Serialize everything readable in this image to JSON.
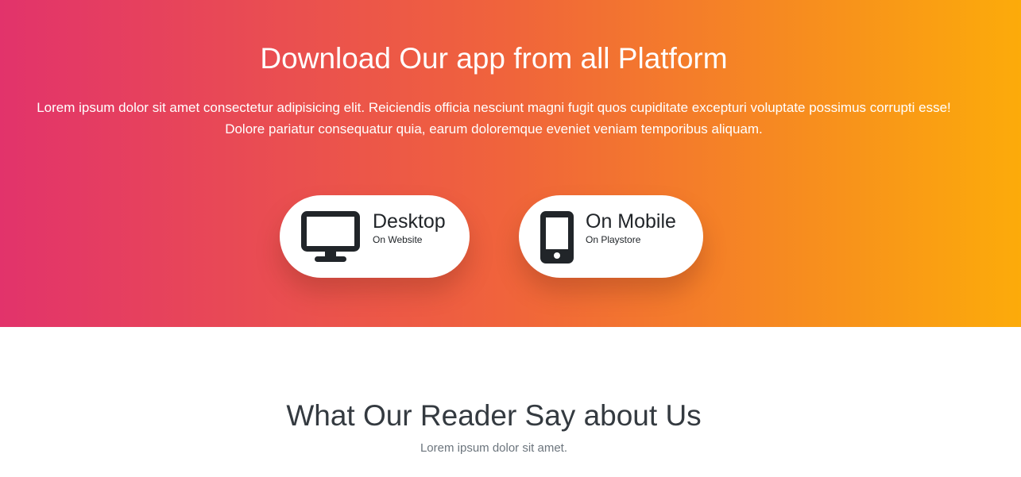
{
  "download": {
    "title": "Download Our app from all Platform",
    "description": "Lorem ipsum dolor sit amet consectetur adipisicing elit. Reiciendis officia nesciunt magni fugit quos cupiditate excepturi voluptate possimus corrupti esse! Dolore pariatur consequatur quia, earum doloremque eveniet veniam temporibus aliquam.",
    "gradient": [
      "#e2336b",
      "#f0643b",
      "#fcab0a"
    ],
    "buttons": [
      {
        "title": "Desktop",
        "subtitle": "On Website",
        "icon": "desktop-icon"
      },
      {
        "title": "On Mobile",
        "subtitle": "On Playstore",
        "icon": "mobile-phone-icon"
      }
    ]
  },
  "testimonials": {
    "title": "What Our Reader Say about Us",
    "subtitle": "Lorem ipsum dolor sit amet."
  }
}
